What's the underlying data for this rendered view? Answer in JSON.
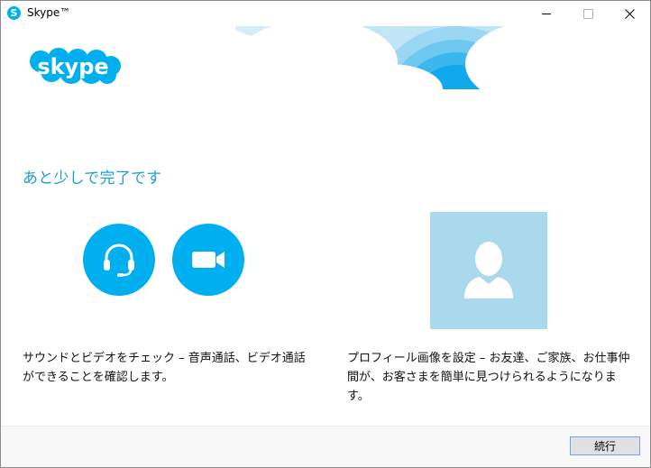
{
  "window": {
    "title": "Skype™",
    "app_icon_glyph": "S",
    "controls": [
      "minimize-icon",
      "maximize-icon",
      "close-icon"
    ]
  },
  "logo_text": "skype",
  "heading": "あと少しで完了です",
  "features": {
    "left": {
      "icons": [
        "headset-icon",
        "video-camera-icon"
      ],
      "description": "サウンドとビデオをチェック – 音声通話、ビデオ通話ができることを確認します。"
    },
    "right": {
      "icon": "user-silhouette-icon",
      "description": "プロフィール画像を設定 – お友達、ご家族、お仕事仲間が、お客さまを簡単に見つけられるようになります。"
    }
  },
  "footer": {
    "continue_label": "続行"
  },
  "colors": {
    "brand": "#00aff0",
    "heading": "#1d9fd8",
    "profile_tile": "#a9d9ec",
    "cloud_sky": "#cde9f6"
  }
}
